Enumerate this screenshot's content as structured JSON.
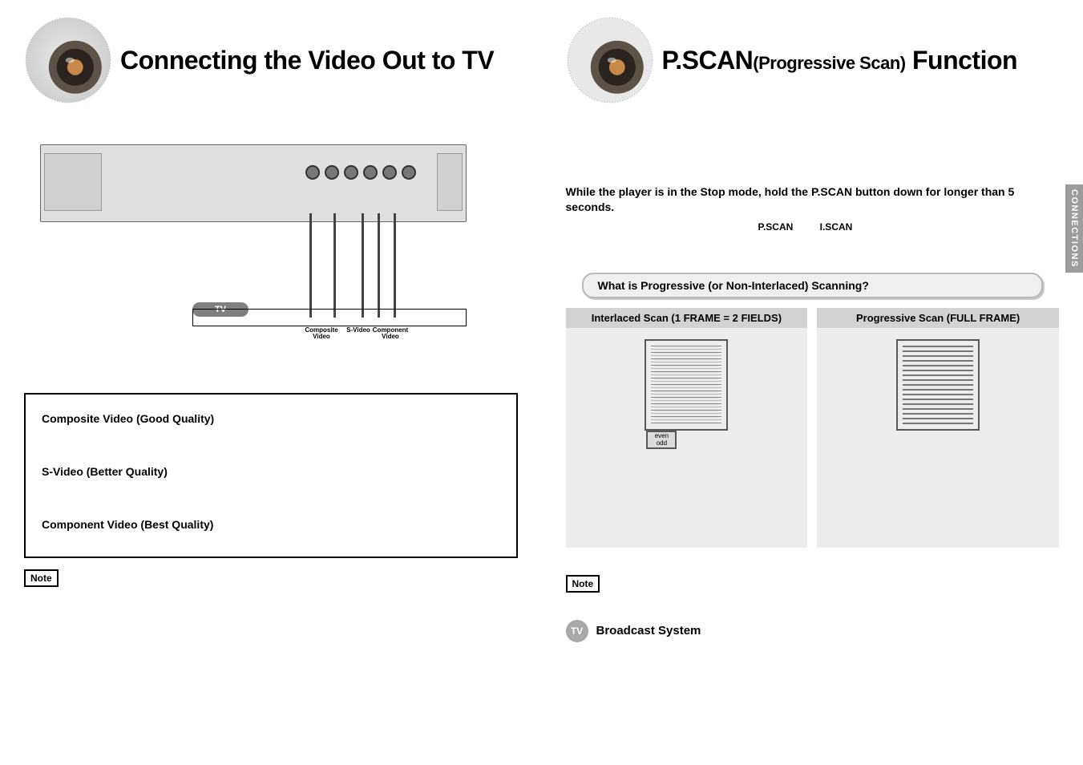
{
  "side_tab": "CONNECTIONS",
  "left": {
    "title": "Connecting the Video Out to TV",
    "tv_label": "TV",
    "tv_subs": {
      "a": "Composite\nVideo",
      "b": "S-Video",
      "c": "Component\nVideo"
    },
    "quality": {
      "composite": "Composite Video (Good Quality)",
      "svideo": "S-Video (Better Quality)",
      "component": "Component Video (Best Quality)"
    },
    "note": "Note"
  },
  "right": {
    "title_main": "P.SCAN",
    "title_paren": "(Progressive Scan)",
    "title_end": " Function",
    "instruction": "While the player is in the Stop mode, hold the P.SCAN button down for longer than 5 seconds.",
    "scan_labels": {
      "pscan": "P.SCAN",
      "iscan": "I.SCAN"
    },
    "question": "What is Progressive (or Non-Interlaced) Scanning?",
    "compare": {
      "interlaced_head": "Interlaced Scan (1 FRAME = 2 FIELDS)",
      "progressive_head": "Progressive Scan (FULL FRAME)",
      "even": "even",
      "odd": "odd"
    },
    "note": "Note",
    "tv_circle": "TV",
    "tv_system": "Broadcast System"
  }
}
